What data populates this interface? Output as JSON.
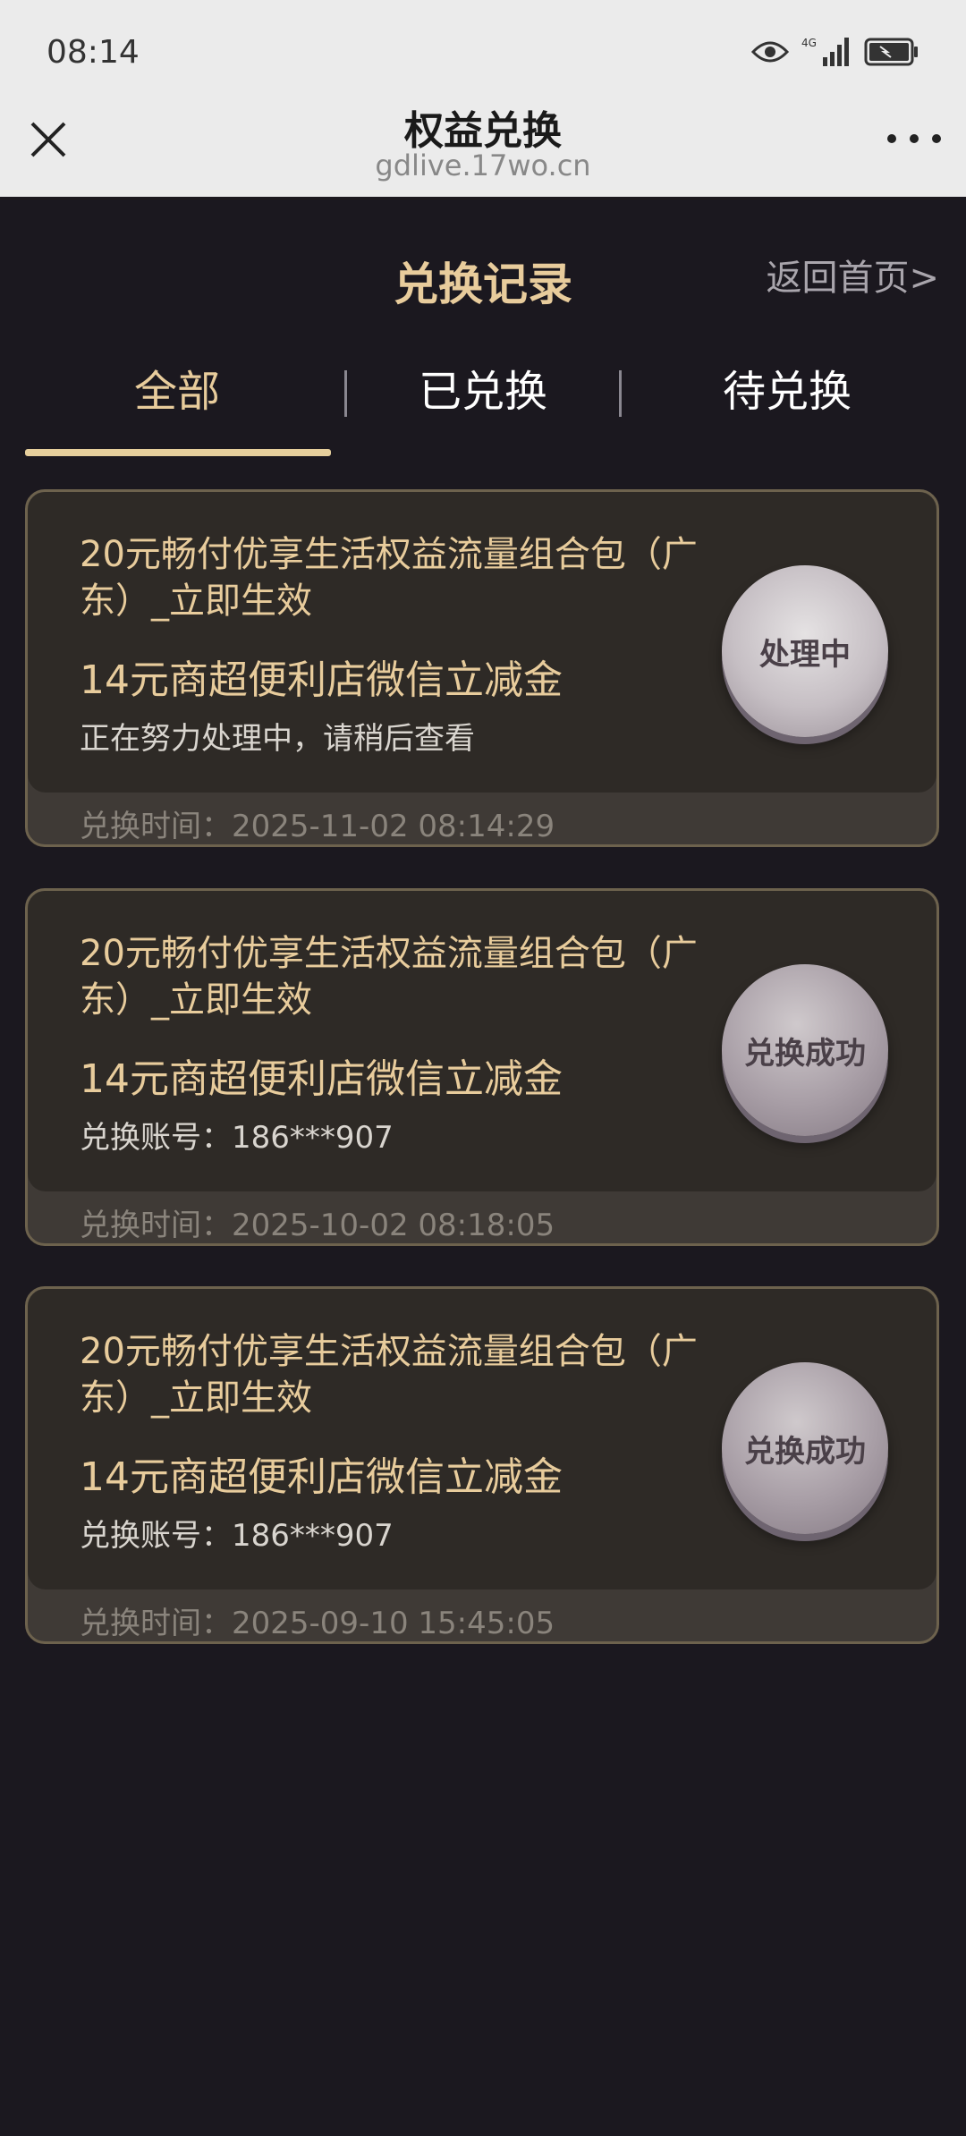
{
  "status_bar": {
    "time": "08:14",
    "signal_label": "4G"
  },
  "browser": {
    "title": "权益兑换",
    "url": "gdlive.17wo.cn"
  },
  "page": {
    "title": "兑换记录",
    "back_link": "返回首页>"
  },
  "tabs": [
    {
      "label": "全部",
      "active": true
    },
    {
      "label": "已兑换",
      "active": false
    },
    {
      "label": "待兑换",
      "active": false
    }
  ],
  "records": [
    {
      "title": "20元畅付优享生活权益流量组合包（广东）_立即生效",
      "subtitle": "14元商超便利店微信立减金",
      "note": "正在努力处理中，请稍后查看",
      "time": "兑换时间：2025-11-02 08:14:29",
      "status": "处理中"
    },
    {
      "title": "20元畅付优享生活权益流量组合包（广东）_立即生效",
      "subtitle": "14元商超便利店微信立减金",
      "note": "兑换账号：186***907",
      "time": "兑换时间：2025-10-02 08:18:05",
      "status": "兑换成功"
    },
    {
      "title": "20元畅付优享生活权益流量组合包（广东）_立即生效",
      "subtitle": "14元商超便利店微信立减金",
      "note": "兑换账号：186***907",
      "time": "兑换时间：2025-09-10 15:45:05",
      "status": "兑换成功"
    }
  ]
}
